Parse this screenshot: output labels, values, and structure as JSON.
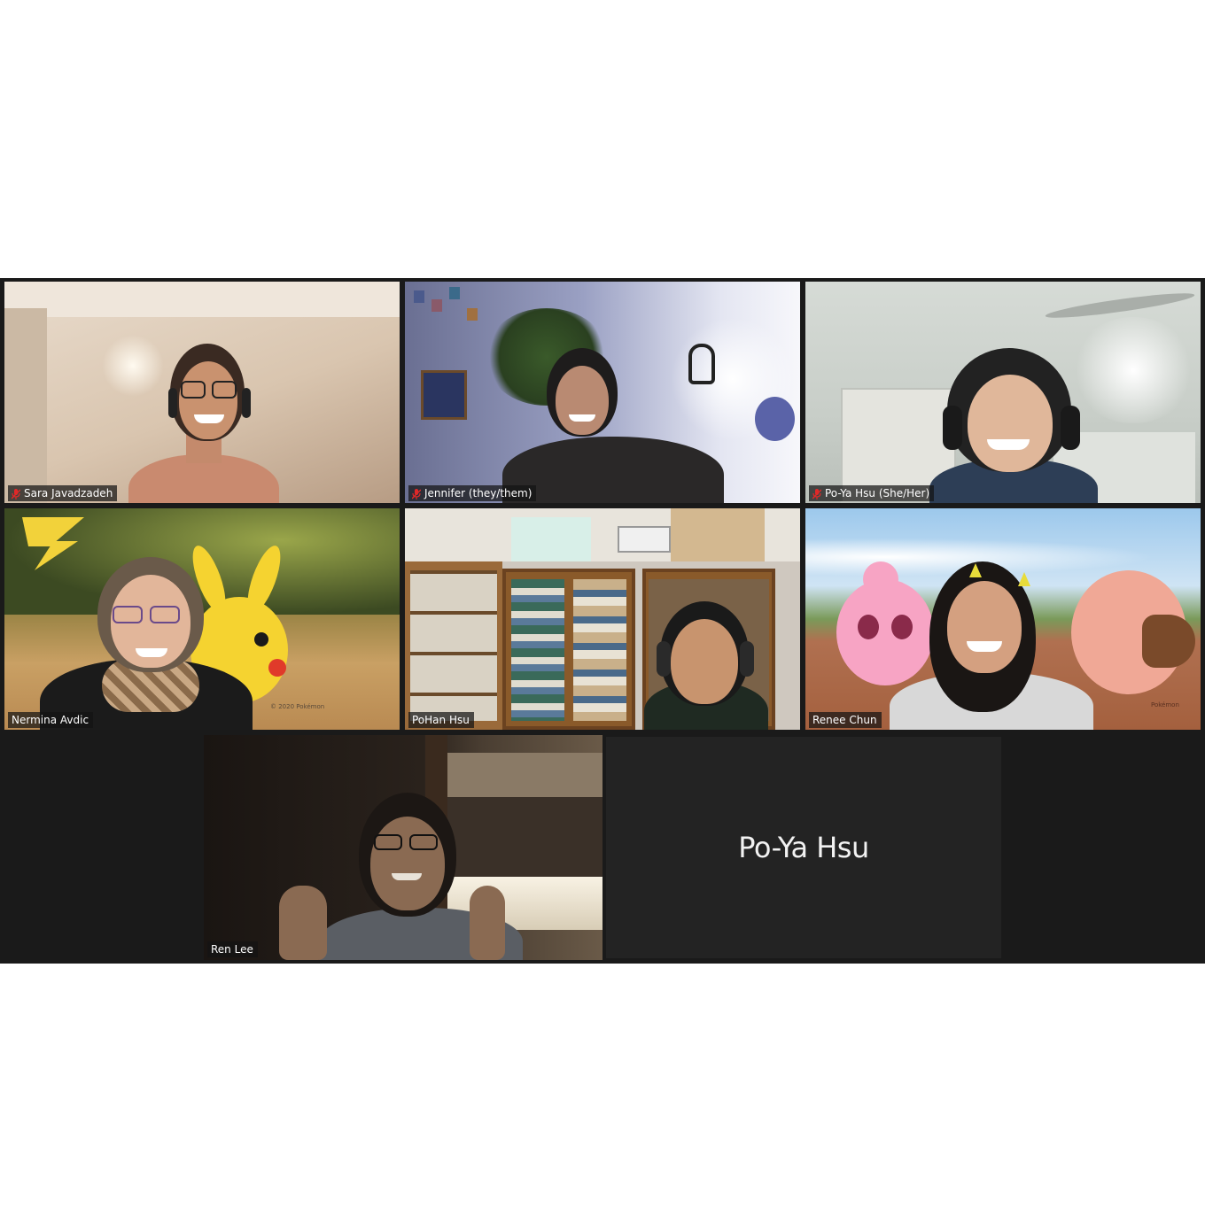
{
  "gallery": {
    "tiles": [
      {
        "id": "sara",
        "name": "Sara Javadzadeh",
        "muted": true,
        "speaking": false
      },
      {
        "id": "jennifer",
        "name": "Jennifer (they/them)",
        "muted": true,
        "speaking": false
      },
      {
        "id": "poya-video",
        "name": "Po-Ya Hsu (She/Her)",
        "muted": true,
        "speaking": false
      },
      {
        "id": "nermina",
        "name": "Nermina Avdic",
        "muted": false,
        "speaking": false,
        "bg_caption": "© 2020 Pokémon"
      },
      {
        "id": "pohan",
        "name": "PoHan Hsu",
        "muted": false,
        "speaking": false
      },
      {
        "id": "renee",
        "name": "Renee Chun",
        "muted": false,
        "speaking": false,
        "bg_caption": "Pokémon"
      },
      {
        "id": "ren",
        "name": "Ren Lee",
        "muted": false,
        "speaking": true
      }
    ],
    "name_card": {
      "name": "Po-Ya Hsu"
    }
  },
  "colors": {
    "gallery_bg": "#1a1a1a",
    "active_speaker_border": "#d8e07a",
    "muted_icon": "#e02828"
  },
  "icons": [
    "mic-muted-icon"
  ]
}
